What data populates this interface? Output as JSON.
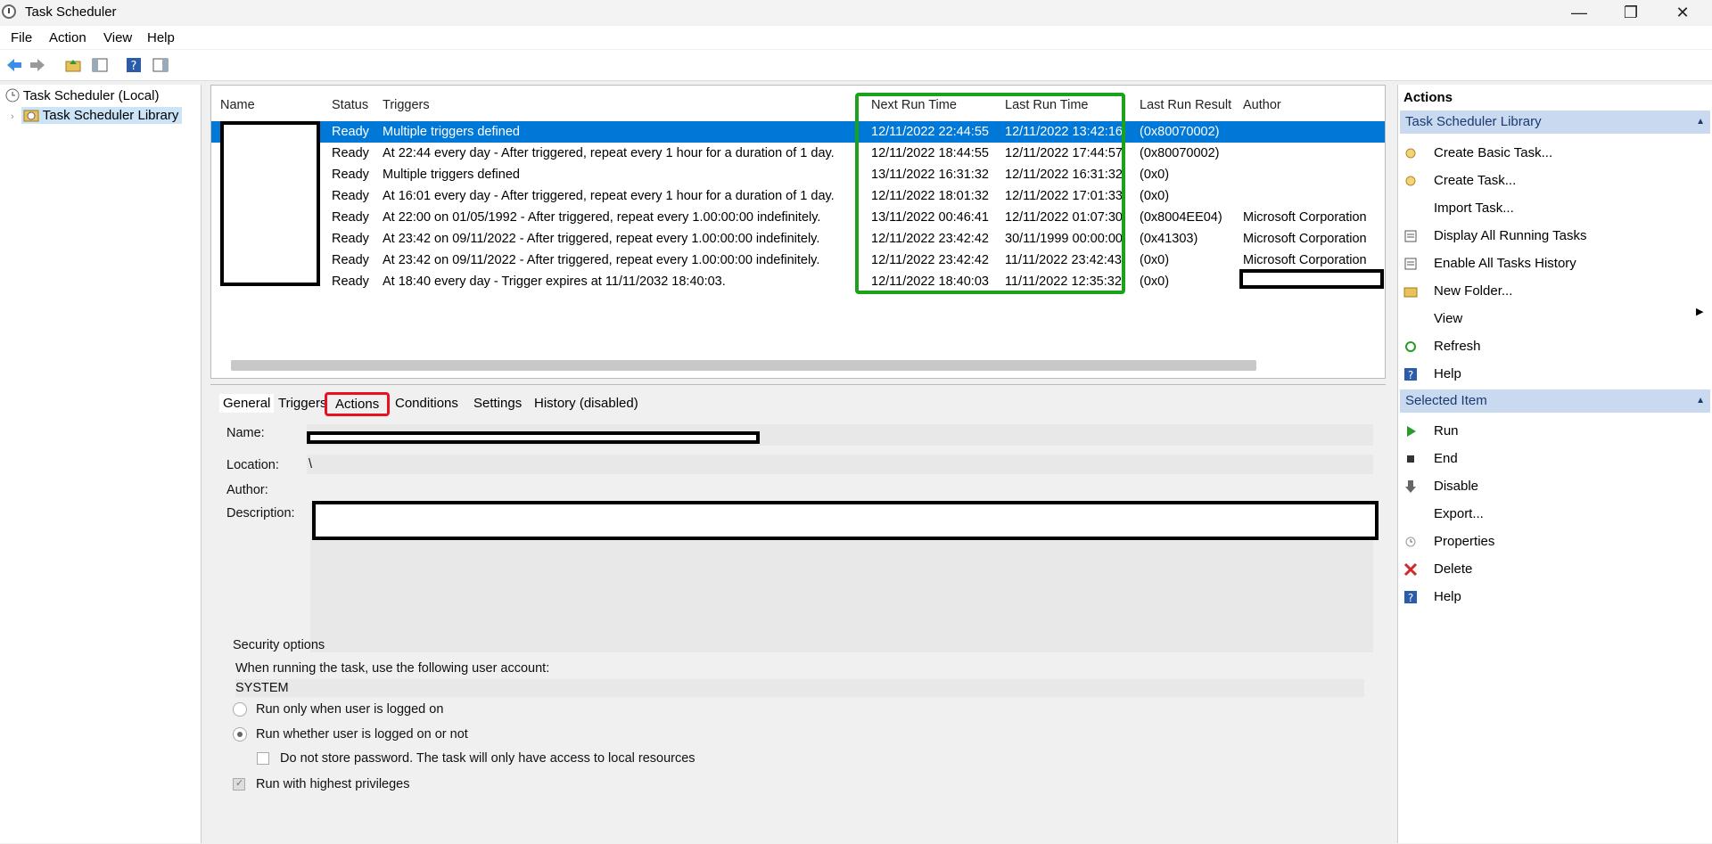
{
  "window": {
    "title": "Task Scheduler",
    "minimize": "—",
    "restore": "❐",
    "close": "✕"
  },
  "menu": [
    "File",
    "Action",
    "View",
    "Help"
  ],
  "tree": {
    "root": "Task Scheduler (Local)",
    "library": "Task Scheduler Library"
  },
  "tasklist": {
    "columns": [
      "Name",
      "Status",
      "Triggers",
      "Next Run Time",
      "Last Run Time",
      "Last Run Result",
      "Author"
    ],
    "rows": [
      {
        "status": "Ready",
        "triggers": "Multiple triggers defined",
        "next": "12/11/2022 22:44:55",
        "last": "12/11/2022 13:42:16",
        "result": "(0x80070002)",
        "author": ""
      },
      {
        "status": "Ready",
        "triggers": "At 22:44 every day - After triggered, repeat every 1 hour for a duration of 1 day.",
        "next": "12/11/2022 18:44:55",
        "last": "12/11/2022 17:44:57",
        "result": "(0x80070002)",
        "author": ""
      },
      {
        "status": "Ready",
        "triggers": "Multiple triggers defined",
        "next": "13/11/2022 16:31:32",
        "last": "12/11/2022 16:31:32",
        "result": "(0x0)",
        "author": ""
      },
      {
        "status": "Ready",
        "triggers": "At 16:01 every day - After triggered, repeat every 1 hour for a duration of 1 day.",
        "next": "12/11/2022 18:01:32",
        "last": "12/11/2022 17:01:33",
        "result": "(0x0)",
        "author": ""
      },
      {
        "status": "Ready",
        "triggers": "At 22:00 on 01/05/1992 - After triggered, repeat every 1.00:00:00 indefinitely.",
        "next": "13/11/2022 00:46:41",
        "last": "12/11/2022 01:07:30",
        "result": "(0x8004EE04)",
        "author": "Microsoft Corporation"
      },
      {
        "status": "Ready",
        "triggers": "At 23:42 on 09/11/2022 - After triggered, repeat every 1.00:00:00 indefinitely.",
        "next": "12/11/2022 23:42:42",
        "last": "30/11/1999 00:00:00",
        "result": "(0x41303)",
        "author": "Microsoft Corporation"
      },
      {
        "status": "Ready",
        "triggers": "At 23:42 on 09/11/2022 - After triggered, repeat every 1.00:00:00 indefinitely.",
        "next": "12/11/2022 23:42:42",
        "last": "11/11/2022 23:42:43",
        "result": "(0x0)",
        "author": "Microsoft Corporation"
      },
      {
        "status": "Ready",
        "triggers": "At 18:40 every day - Trigger expires at 11/11/2032 18:40:03.",
        "next": "12/11/2022 18:40:03",
        "last": "11/11/2022 12:35:32",
        "result": "(0x0)",
        "author": ""
      }
    ]
  },
  "details": {
    "tabs": [
      "General",
      "Triggers",
      "Actions",
      "Conditions",
      "Settings",
      "History (disabled)"
    ],
    "name_label": "Name:",
    "location_label": "Location:",
    "location_value": "\\",
    "author_label": "Author:",
    "description_label": "Description:",
    "security_title": "Security options",
    "account_prompt": "When running the task, use the following user account:",
    "account_value": "SYSTEM",
    "radio1": "Run only when user is logged on",
    "radio2": "Run whether user is logged on or not",
    "no_store": "Do not store password.  The task will only have access to local resources",
    "highest": "Run with highest privileges"
  },
  "actions": {
    "header": "Actions",
    "section1": "Task Scheduler Library",
    "items1": [
      "Create Basic Task...",
      "Create Task...",
      "Import Task...",
      "Display All Running Tasks",
      "Enable All Tasks History",
      "New Folder...",
      "View",
      "Refresh",
      "Help"
    ],
    "section2": "Selected Item",
    "items2": [
      "Run",
      "End",
      "Disable",
      "Export...",
      "Properties",
      "Delete",
      "Help"
    ]
  },
  "colors": {
    "selection": "#0078d7",
    "highlight_green": "#1aa31a",
    "highlight_red": "#e81123",
    "section_bar": "#c9daf0"
  }
}
